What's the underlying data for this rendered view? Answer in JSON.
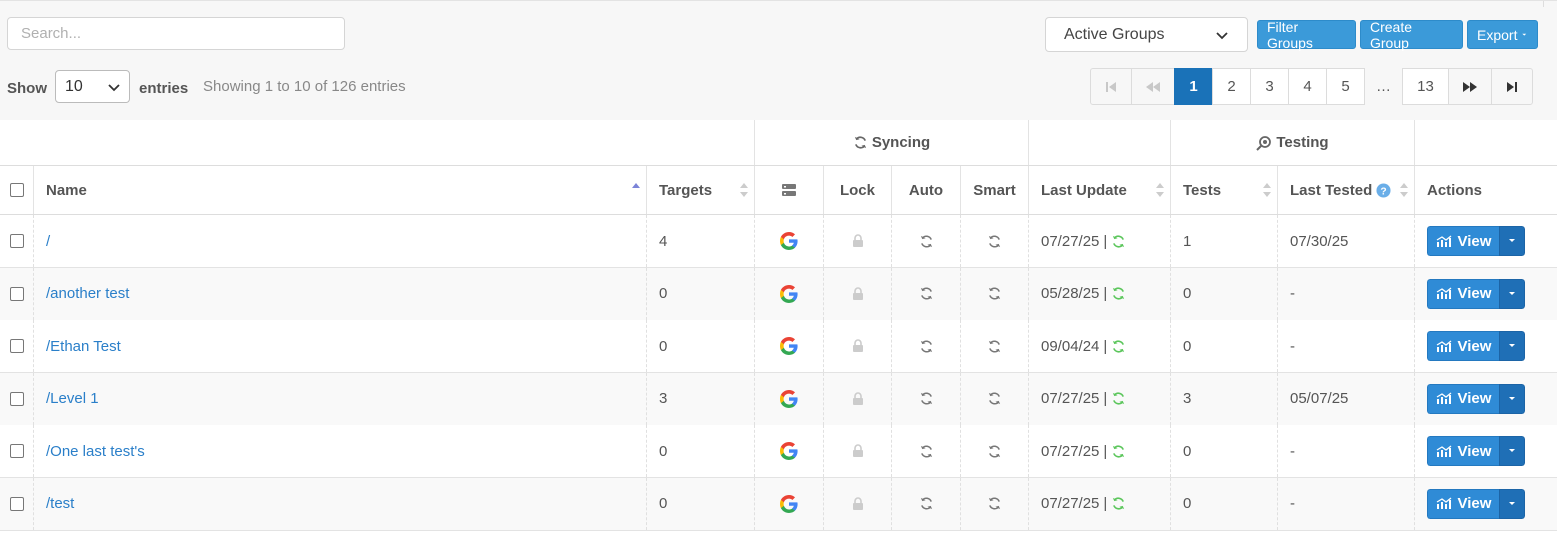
{
  "toolbar": {
    "search_placeholder": "Search...",
    "group_filter_value": "Active Groups",
    "filter_groups_label": "Filter Groups",
    "create_group_label": "Create Group",
    "export_label": "Export"
  },
  "length": {
    "show_label": "Show",
    "value": "10",
    "entries_label": "entries"
  },
  "info": "Showing 1 to 10 of 126 entries",
  "pagination": {
    "pages": [
      "1",
      "2",
      "3",
      "4",
      "5"
    ],
    "ellipsis": "…",
    "last_page": "13",
    "active": "1"
  },
  "groups": {
    "syncing": "Syncing",
    "testing": "Testing"
  },
  "columns": {
    "name": "Name",
    "targets": "Targets",
    "lock": "Lock",
    "auto": "Auto",
    "smart": "Smart",
    "last_update": "Last Update",
    "tests": "Tests",
    "last_tested": "Last Tested",
    "actions": "Actions"
  },
  "rows": [
    {
      "name": "/",
      "targets": "4",
      "last_update": "07/27/25",
      "tests": "1",
      "last_tested": "07/30/25"
    },
    {
      "name": "/another test",
      "targets": "0",
      "last_update": "05/28/25",
      "tests": "0",
      "last_tested": "-"
    },
    {
      "name": "/Ethan Test",
      "targets": "0",
      "last_update": "09/04/24",
      "tests": "0",
      "last_tested": "-"
    },
    {
      "name": "/Level 1",
      "targets": "3",
      "last_update": "07/27/25",
      "tests": "3",
      "last_tested": "05/07/25"
    },
    {
      "name": "/One last test's",
      "targets": "0",
      "last_update": "07/27/25",
      "tests": "0",
      "last_tested": "-"
    },
    {
      "name": "/test",
      "targets": "0",
      "last_update": "07/27/25",
      "tests": "0",
      "last_tested": "-"
    }
  ],
  "row_separator": "|",
  "view_label": "View",
  "colors": {
    "primary": "#3b9ad9",
    "active_page": "#1a72b8",
    "link": "#2a7fc9",
    "sync_green": "#5cc65c"
  }
}
